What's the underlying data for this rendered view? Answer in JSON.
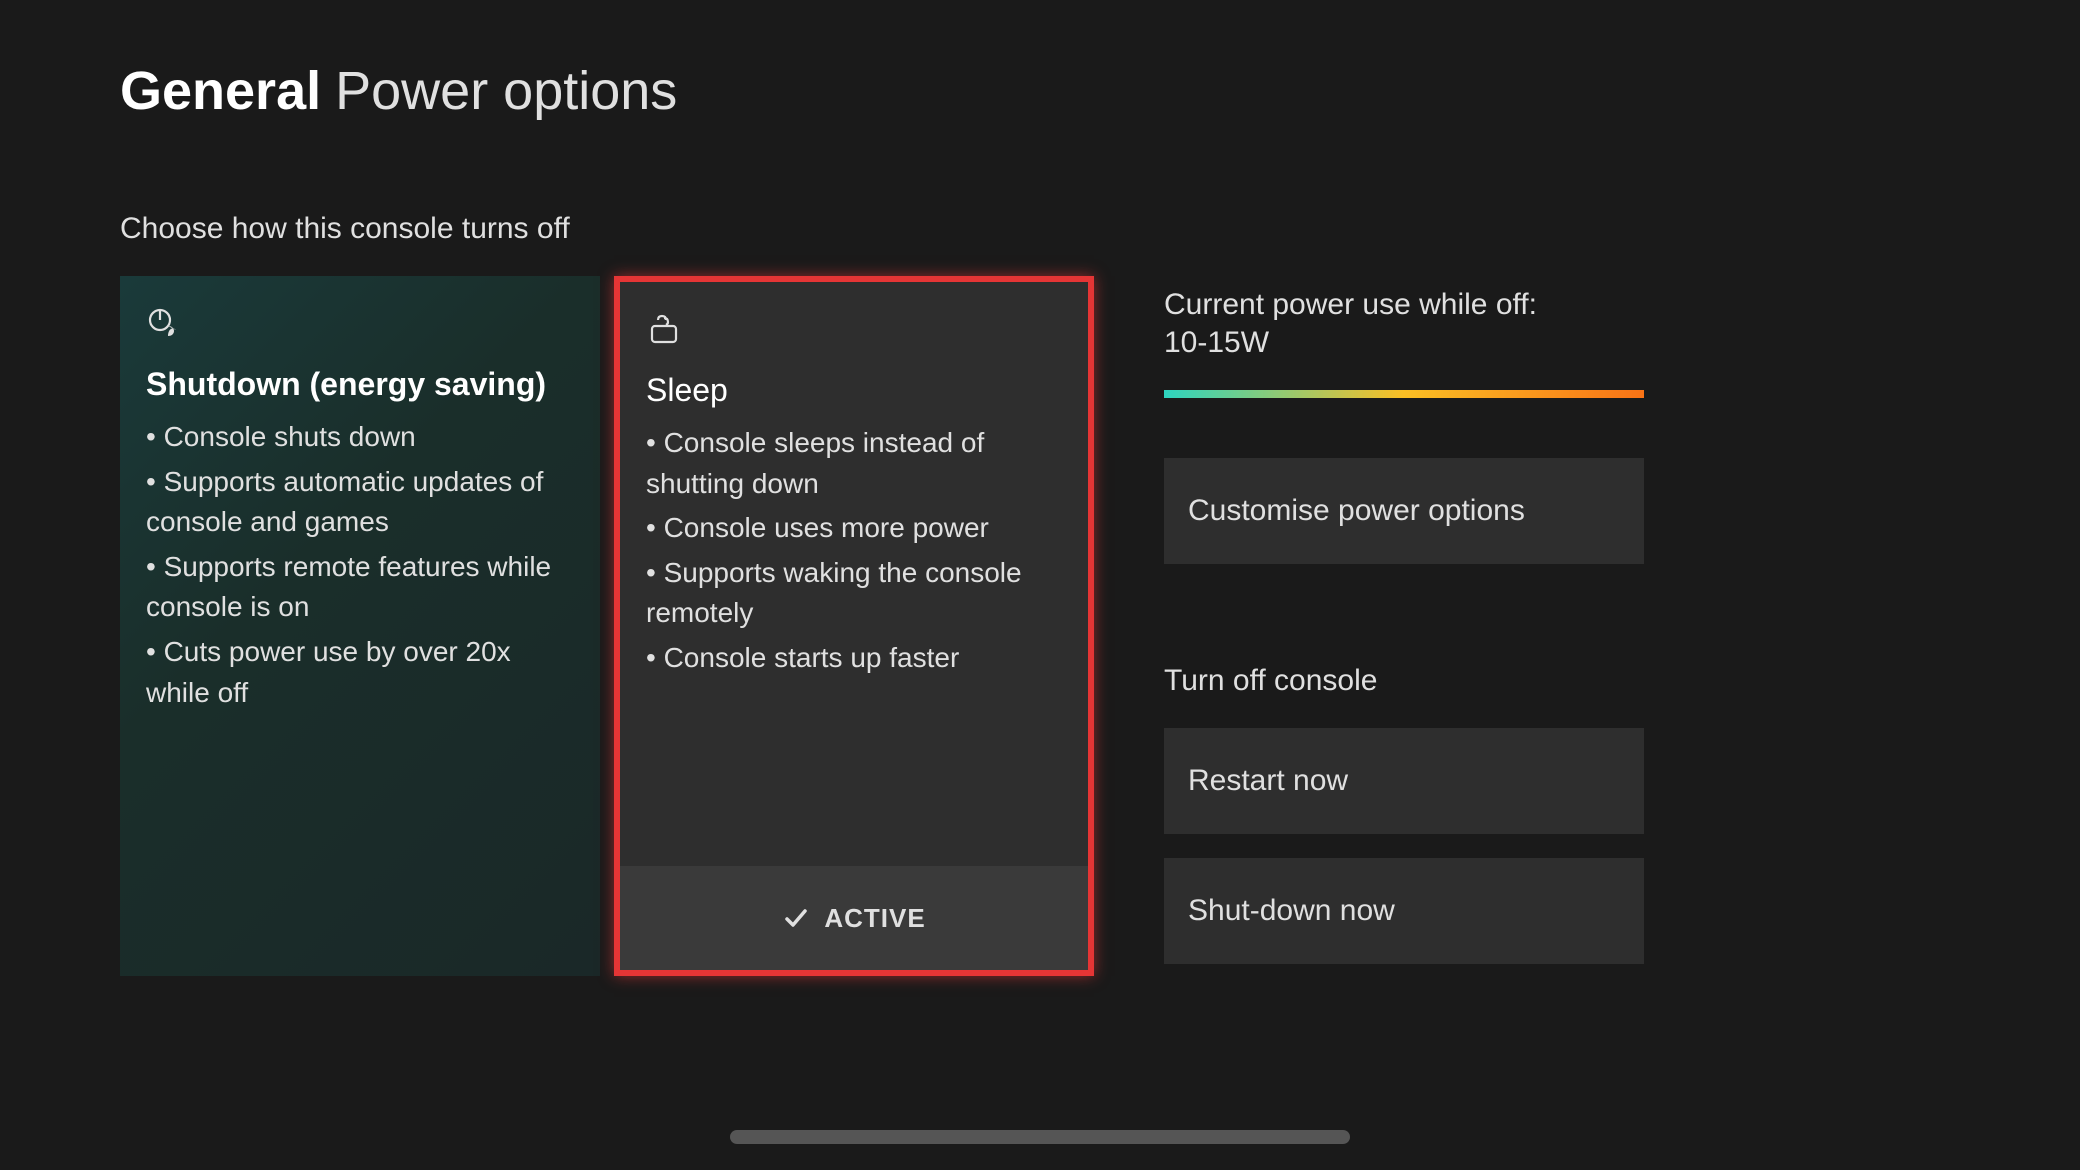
{
  "header": {
    "category": "General",
    "title": "Power options"
  },
  "section_label": "Choose how this console turns off",
  "cards": {
    "shutdown": {
      "title": "Shutdown (energy saving)",
      "bullets": [
        "• Console shuts down",
        "• Supports automatic updates of console and games",
        "• Supports remote features while console is on",
        "• Cuts power use by over 20x while off"
      ]
    },
    "sleep": {
      "title": "Sleep",
      "bullets": [
        "• Console sleeps instead of shutting down",
        "• Console uses more power",
        "• Supports waking the console remotely",
        "• Console starts up faster"
      ],
      "active_label": "ACTIVE"
    }
  },
  "right": {
    "power_label": "Current power use while off:",
    "power_value": "10-15W",
    "customise_label": "Customise power options",
    "turn_off_label": "Turn off console",
    "restart_label": "Restart now",
    "shutdown_label": "Shut-down now"
  }
}
